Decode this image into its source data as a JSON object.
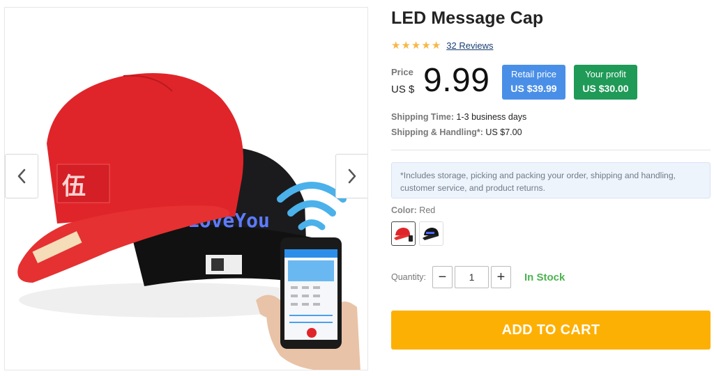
{
  "product": {
    "title": "LED Message Cap",
    "rating": 5,
    "reviews_label": "32 Reviews"
  },
  "gallery": {
    "image_alt": "LED message caps with phone app",
    "hat_led_text": "ILoveYou",
    "prev_icon": "chevron-left-icon",
    "next_icon": "chevron-right-icon"
  },
  "pricing": {
    "price_label": "Price",
    "currency": "US $",
    "price": "9.99",
    "retail_label": "Retail price",
    "retail_value": "US $39.99",
    "profit_label": "Your profit",
    "profit_value": "US $30.00",
    "colors": {
      "retail": "#4a8fe7",
      "profit": "#1f9a57"
    }
  },
  "shipping": {
    "time_label": "Shipping Time:",
    "time_value": "1-3 business days",
    "handling_label": "Shipping & Handling*:",
    "handling_value": "US $7.00"
  },
  "note": "*Includes storage, picking and packing your order, shipping and handling, customer service, and product returns.",
  "variant": {
    "color_label": "Color:",
    "color_value": "Red",
    "swatches": [
      "Red",
      "Black"
    ]
  },
  "quantity": {
    "label": "Quantity:",
    "value": "1",
    "minus": "−",
    "plus": "+"
  },
  "stock_status": "In Stock",
  "cart": {
    "label": "ADD TO CART",
    "color": "#fdb004"
  }
}
